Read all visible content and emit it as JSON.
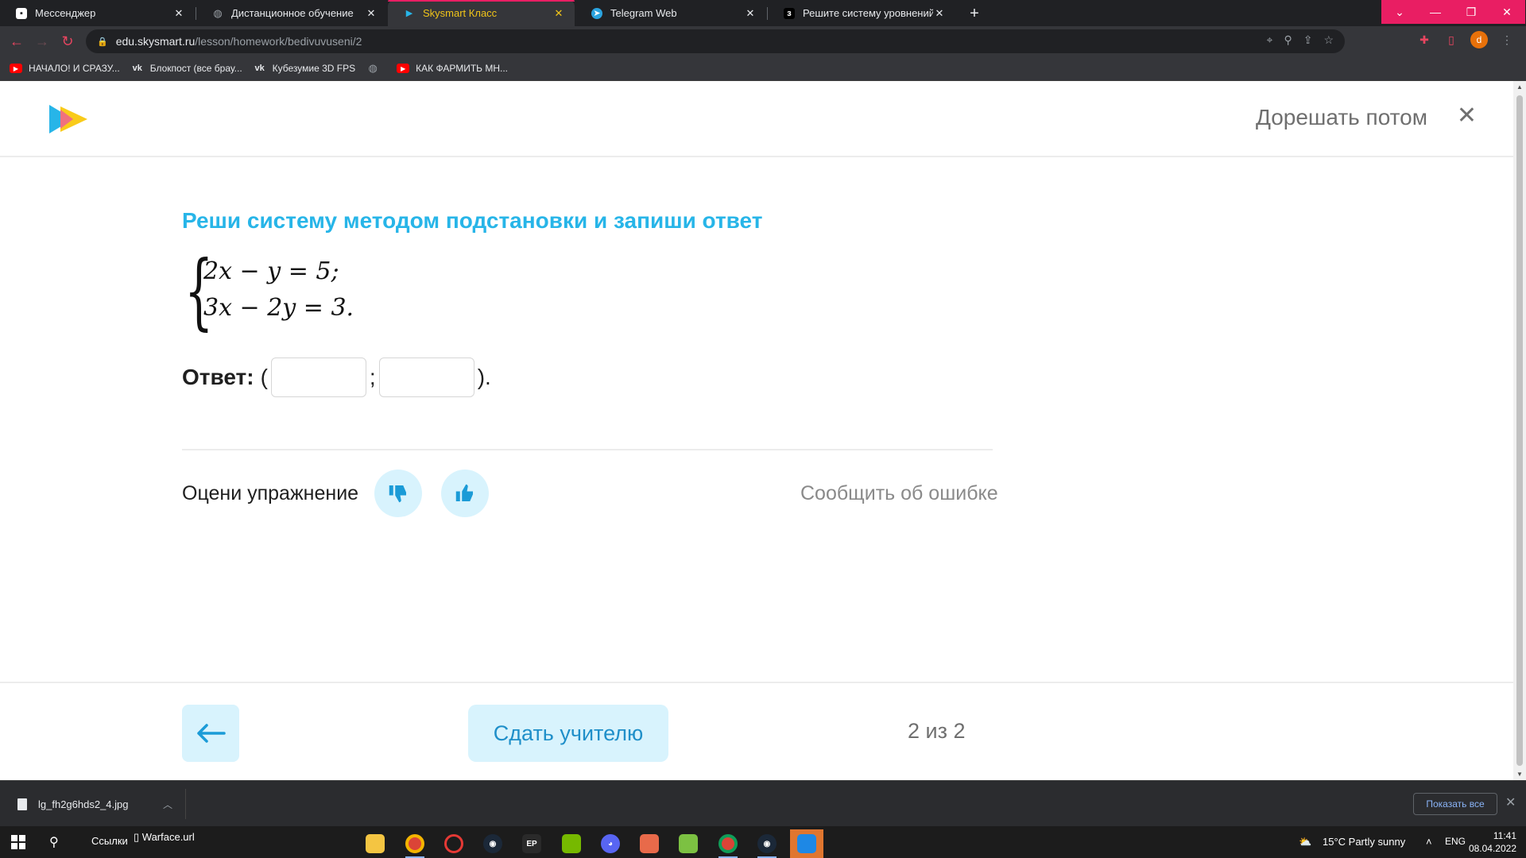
{
  "browser": {
    "tabs": [
      {
        "label": "Мессенджер"
      },
      {
        "label": "Дистанционное обучение"
      },
      {
        "label": "Skysmart Класс"
      },
      {
        "label": "Telegram Web"
      },
      {
        "label": "Решите систему уровнений!!! у"
      }
    ],
    "url_host": "edu.skysmart.ru",
    "url_path": "/lesson/homework/bedivuvuseni/2",
    "avatar_letter": "d",
    "bookmarks": [
      {
        "label": "НАЧАЛО! И СРАЗУ...",
        "icon": "youtube-icon"
      },
      {
        "label": "Блокпост (все брау...",
        "icon": "vk-icon"
      },
      {
        "label": "Кубезумие 3D FPS",
        "icon": "vk-icon"
      },
      {
        "label": "",
        "icon": "globe-icon"
      },
      {
        "label": "КАК ФАРМИТЬ МН...",
        "icon": "youtube-icon"
      }
    ]
  },
  "page": {
    "later_label": "Дорешать потом",
    "task_title": "Реши систему методом подстановки и запиши ответ",
    "equation_1": "2x − y = 5;",
    "equation_2": "3x − 2y = 3.",
    "answer_label": "Ответ:",
    "answer_open": "(",
    "answer_sep": ";",
    "answer_close": ").",
    "answer_x": "",
    "answer_y": "",
    "rate_label": "Оцени упражнение",
    "report_label": "Сообщить об ошибке",
    "submit_label": "Сдать учителю",
    "pager": "2 из 2",
    "accent_color": "#27b5e8"
  },
  "downloads": {
    "file_name": "lg_fh2g6hds2_4.jpg",
    "show_all": "Показать все"
  },
  "taskbar": {
    "links_label": "Ссылки",
    "pinned_file": "Warface.url",
    "weather": "15°C  Partly sunny",
    "lang": "ENG",
    "time": "11:41",
    "date": "08.04.2022"
  }
}
